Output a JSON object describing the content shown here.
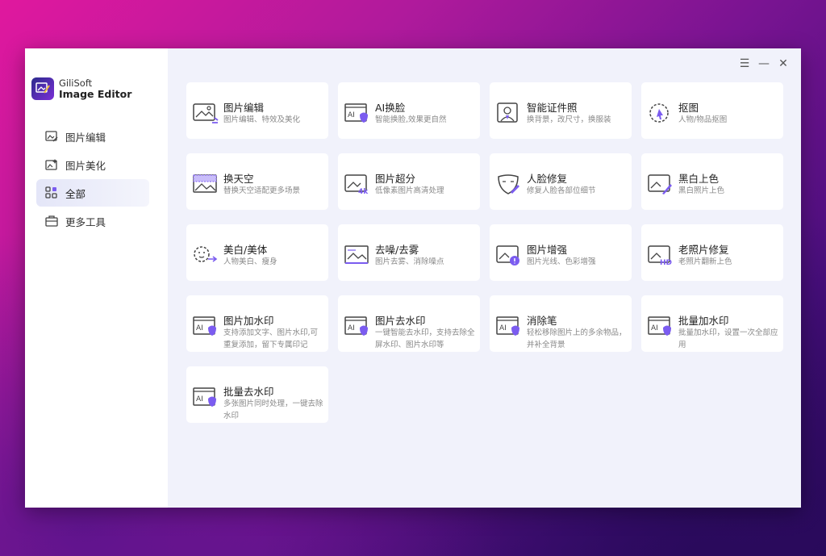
{
  "brand": {
    "name": "GiliSoft",
    "product": "Image Editor"
  },
  "window_controls": {
    "menu": "☰",
    "minimize": "—",
    "close": "✕"
  },
  "sidebar": {
    "items": [
      {
        "label": "图片编辑",
        "icon": "image-edit-icon",
        "active": false
      },
      {
        "label": "图片美化",
        "icon": "image-beautify-icon",
        "active": false
      },
      {
        "label": "全部",
        "icon": "grid-icon",
        "active": true
      },
      {
        "label": "更多工具",
        "icon": "toolbox-icon",
        "active": false
      }
    ]
  },
  "tools": [
    {
      "title": "图片编辑",
      "desc": "图片编辑、特效及美化",
      "icon": "image-edit-icon"
    },
    {
      "title": "AI换脸",
      "desc": "智能换脸,效果更自然",
      "icon": "ai-face-swap-icon"
    },
    {
      "title": "智能证件照",
      "desc": "换背景，改尺寸，换服装",
      "icon": "id-photo-icon"
    },
    {
      "title": "抠图",
      "desc": "人物/物品抠图",
      "icon": "cutout-icon"
    },
    {
      "title": "换天空",
      "desc": "替换天空适配更多场景",
      "icon": "sky-replace-icon"
    },
    {
      "title": "图片超分",
      "desc": "低像素图片高清处理",
      "icon": "upscale-4k-icon"
    },
    {
      "title": "人脸修复",
      "desc": "修复人脸各部位细节",
      "icon": "face-repair-icon"
    },
    {
      "title": "黑白上色",
      "desc": "黑白照片上色",
      "icon": "colorize-icon"
    },
    {
      "title": "美白/美体",
      "desc": "人物美白、瘦身",
      "icon": "beauty-body-icon"
    },
    {
      "title": "去噪/去雾",
      "desc": "图片去雾、消除噪点",
      "icon": "denoise-icon"
    },
    {
      "title": "图片增强",
      "desc": "图片光线、色彩增强",
      "icon": "enhance-icon"
    },
    {
      "title": "老照片修复",
      "desc": "老照片翻新上色",
      "icon": "old-photo-hd-icon"
    },
    {
      "title": "图片加水印",
      "desc": "支持添加文字、图片水印,可重复添加，留下专属印记",
      "icon": "ai-watermark-add-icon"
    },
    {
      "title": "图片去水印",
      "desc": "一键智能去水印，支持去除全屏水印、图片水印等",
      "icon": "ai-watermark-remove-icon"
    },
    {
      "title": "消除笔",
      "desc": "轻松移除图片上的多余物品，并补全背景",
      "icon": "ai-eraser-icon"
    },
    {
      "title": "批量加水印",
      "desc": "批量加水印，设置一次全部应用",
      "icon": "ai-batch-watermark-add-icon"
    },
    {
      "title": "批量去水印",
      "desc": "多张图片同时处理，一键去除水印",
      "icon": "ai-batch-watermark-remove-icon"
    }
  ],
  "colors": {
    "accent": "#7b5cf0",
    "sidebar_active": "#e4e6f8",
    "card_bg": "#ffffff",
    "main_bg": "#f1f2fb"
  }
}
